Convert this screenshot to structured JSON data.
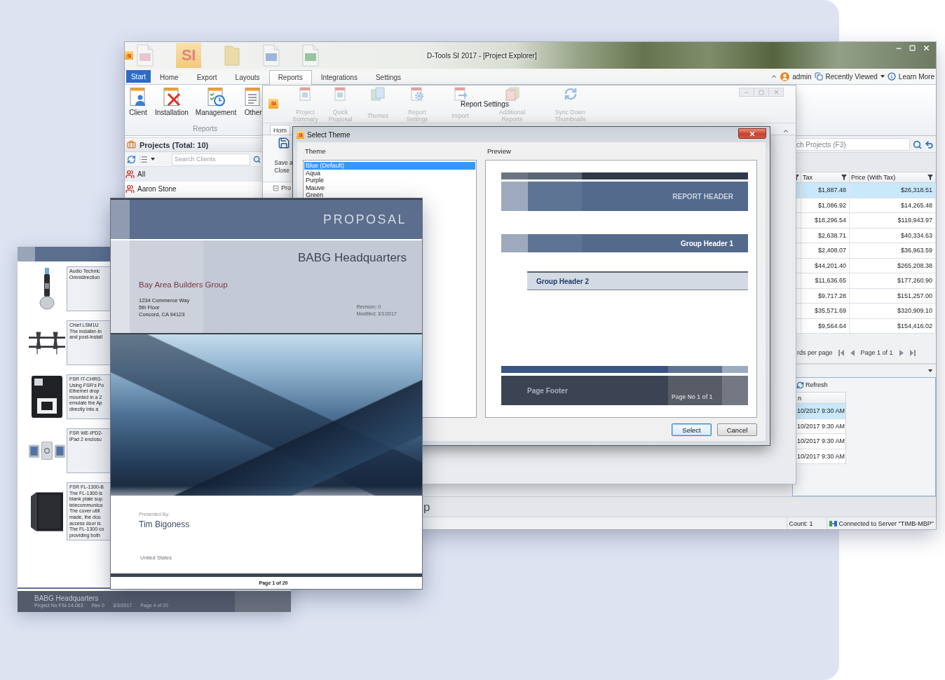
{
  "app_window": {
    "app_logo": "SI",
    "background_logo": "SI",
    "title": "D-Tools SI 2017 - [Project Explorer]",
    "tabs": [
      {
        "label": "Start",
        "kind": "application",
        "selected": false
      },
      {
        "label": "Home",
        "kind": "tab",
        "selected": false
      },
      {
        "label": "Export",
        "kind": "tab",
        "selected": false
      },
      {
        "label": "Layouts",
        "kind": "tab",
        "selected": false
      },
      {
        "label": "Reports",
        "kind": "tab",
        "selected": true
      },
      {
        "label": "Integrations",
        "kind": "tab",
        "selected": false
      },
      {
        "label": "Settings",
        "kind": "tab",
        "selected": false
      }
    ],
    "user": "admin",
    "recently_viewed": "Recently Viewed",
    "learn_more": "Learn More",
    "ribbon": {
      "buttons": [
        "Client",
        "Installation",
        "Management",
        "Other"
      ],
      "group_label": "Reports"
    },
    "projects_panel": {
      "title": "Projects (Total: 10)",
      "search": {
        "placeholder": "Search Clients"
      },
      "items": [
        {
          "label": "All",
          "selected": true
        },
        {
          "label": "Aaron Stone",
          "selected": false
        }
      ]
    },
    "project_search": {
      "placeholder": "ch Projects (F3)"
    },
    "table": {
      "columns": [
        "Tax",
        "Price (With Tax)"
      ],
      "rows": [
        {
          "cells": [
            "$1,887.48",
            "$26,318.51"
          ],
          "selected": true
        },
        {
          "cells": [
            "$1,086.92",
            "$14,265.48"
          ],
          "selected": false
        },
        {
          "cells": [
            "$18,296.54",
            "$119,943.97"
          ],
          "selected": false
        },
        {
          "cells": [
            "$2,638.71",
            "$40,334.63"
          ],
          "selected": false
        },
        {
          "cells": [
            "$2,408.07",
            "$36,963.59"
          ],
          "selected": false
        },
        {
          "cells": [
            "$44,201.40",
            "$265,208.38"
          ],
          "selected": false
        },
        {
          "cells": [
            "$11,636.65",
            "$177,260.90"
          ],
          "selected": false
        },
        {
          "cells": [
            "$9,717.28",
            "$151,257.00"
          ],
          "selected": false
        },
        {
          "cells": [
            "$35,571.69",
            "$320,909.10"
          ],
          "selected": false
        },
        {
          "cells": [
            "$9,564.64",
            "$154,416.02"
          ],
          "selected": false
        }
      ]
    },
    "pager": {
      "records_label": "rds per page",
      "page_label": "Page 1 of 1"
    },
    "activity_panel": {
      "refresh": "Refresh",
      "column": "n",
      "rows": [
        {
          "text": "10/2017 9:30 AM",
          "selected": true
        },
        {
          "text": "10/2017 9:30 AM",
          "selected": false
        },
        {
          "text": "10/2017 9:30 AM",
          "selected": false
        },
        {
          "text": "10/2017 9:30 AM",
          "selected": false
        }
      ]
    },
    "bottom_fragment": "p",
    "status_bar": {
      "count": "Count: 1",
      "connection": "Connected to Server \"TIMB-MBP\""
    }
  },
  "designer_window": {
    "logo": "SI",
    "ribbon_buttons": [
      "Project Summary",
      "Quick Proposal",
      "Themes",
      "Report Settings",
      "Import",
      "Additional Reports",
      "Sync Down Thumbnails"
    ],
    "tooltip": "Report Settings",
    "tab": {
      "label": "Hom",
      "selected": true
    },
    "save_button": [
      "Save a",
      "Close"
    ],
    "tree_item": "Pro"
  },
  "theme_dialog": {
    "logo": "SI",
    "title": "Select Theme",
    "theme_label": "Theme",
    "themes": [
      {
        "name": "Blue (Default)",
        "selected": true
      },
      {
        "name": "Aqua",
        "selected": false
      },
      {
        "name": "Purple",
        "selected": false
      },
      {
        "name": "Mauve",
        "selected": false
      },
      {
        "name": "Green",
        "selected": false
      }
    ],
    "preview_label": "Preview",
    "preview": {
      "report_header": "REPORT HEADER",
      "group_header_1": "Group Header 1",
      "group_header_2": "Group Header 2",
      "page_footer": "Page Footer",
      "page_number": "Page No 1 of 1"
    },
    "buttons": [
      {
        "label": "Select",
        "default": true
      },
      {
        "label": "Cancel",
        "default": false
      }
    ]
  },
  "proposal_page": {
    "heading": "PROPOSAL",
    "project": "BABG Headquarters",
    "client": "Bay Area Builders Group",
    "address": [
      "1234 Commerce Way",
      "5th Floor",
      "Concord, CA 94123"
    ],
    "revision": "Revision: 0",
    "modified": "Modified: 3/1/2017",
    "presented_by_label": "Presented By:",
    "presenter": "Tim Bigoness",
    "country": "United States",
    "page": "Page 1 of 20"
  },
  "products_page": {
    "products": [
      {
        "kind": "microphone",
        "name": "Audio Technic",
        "description_lines": [
          "Omnidirection"
        ]
      },
      {
        "kind": "mount",
        "name": "Chief LSM1U",
        "description_lines": [
          "The installer-in",
          "and post-install"
        ]
      },
      {
        "kind": "charger",
        "name": "FSR IT-CHRG-",
        "description_lines": [
          "Using FSR's Po",
          "Ethernet drop",
          "mounted in a 2",
          "emulate the Ap",
          "directly into a"
        ]
      },
      {
        "kind": "tablets",
        "name": "FSR WE-IPD2-",
        "description_lines": [
          "iPad 2 enclosu"
        ]
      },
      {
        "kind": "wall-box",
        "name": "FSR FL-1300-B",
        "description_lines": [
          "The FL-1300 is",
          "blank plate sup",
          "telecommunica",
          "The cover utili",
          "made, the doo",
          "access door is",
          "The FL-1300 co",
          "providing both"
        ]
      }
    ],
    "footer_title": "BABG Headquarters",
    "footer_meta": [
      "Project No FSI-14-063",
      "Rev 0",
      "3/3/2017",
      "Page 4 of 20"
    ]
  }
}
